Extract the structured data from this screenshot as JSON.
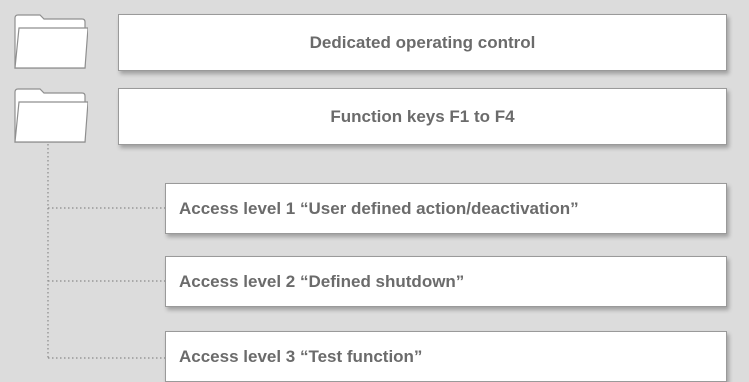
{
  "items": [
    {
      "label": "Dedicated operating control"
    },
    {
      "label": "Function keys F1 to F4"
    }
  ],
  "access_levels": [
    {
      "label": "Access level 1 “User defined action/deactivation”"
    },
    {
      "label": "Access level 2 “Defined shutdown”"
    },
    {
      "label": "Access level 3 “Test function”"
    }
  ],
  "colors": {
    "background": "#dcdcdc",
    "box_fill": "#ffffff",
    "box_border": "#9a9a9a",
    "text": "#6b6b6b",
    "connector": "#8a8a8a"
  },
  "icons": [
    "folder-icon"
  ]
}
